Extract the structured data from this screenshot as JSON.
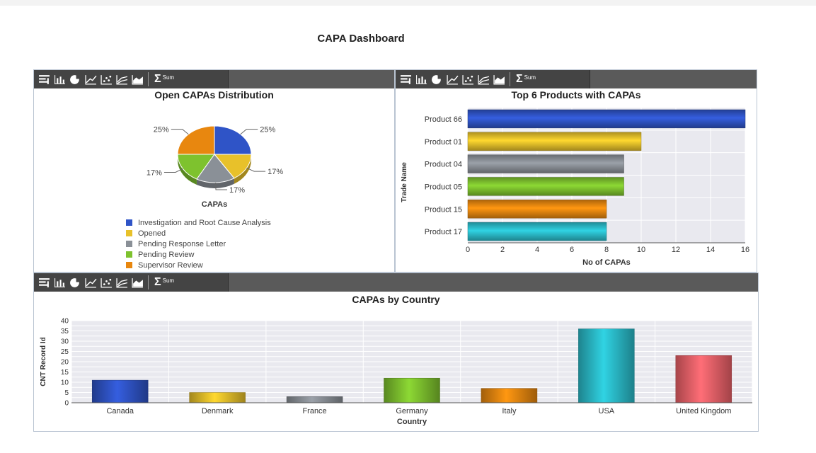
{
  "page_title": "CAPA Dashboard",
  "toolbar": {
    "icons": [
      "grid-icon",
      "bar-chart-icon",
      "pie-chart-icon",
      "line-chart-icon",
      "scatter-chart-icon",
      "multi-line-chart-icon",
      "area-chart-icon",
      "sum-icon"
    ],
    "sum_label": "Sum",
    "sigma": "Σ"
  },
  "chart_data": [
    {
      "type": "pie",
      "title": "Open CAPAs Distribution",
      "xlabel": "CAPAs",
      "slices": [
        {
          "label": "Investigation and Root Cause Analysis",
          "value": 25,
          "pct_label": "25%",
          "color": "#2f54c7"
        },
        {
          "label": "Opened",
          "value": 16,
          "pct_label": "17%",
          "color": "#e8c12a"
        },
        {
          "label": "Pending Response Letter",
          "value": 17,
          "pct_label": "17%",
          "color": "#8a9097"
        },
        {
          "label": "Pending Review",
          "value": 17,
          "pct_label": "17%",
          "color": "#7ec22e"
        },
        {
          "label": "Supervisor Review",
          "value": 25,
          "pct_label": "25%",
          "color": "#e8870f"
        }
      ],
      "legend": "bottom"
    },
    {
      "type": "bar",
      "orientation": "horizontal",
      "title": "Top 6 Products with CAPAs",
      "xlabel": "No of CAPAs",
      "ylabel": "Trade Name",
      "categories": [
        "Product 66",
        "Product 01",
        "Product 04",
        "Product 05",
        "Product 15",
        "Product 17"
      ],
      "values": [
        16,
        10,
        9,
        9,
        8,
        8
      ],
      "colors": [
        "#2f54c7",
        "#e8c12a",
        "#8a9097",
        "#7ec22e",
        "#e8870f",
        "#2bbccb"
      ],
      "xlim": [
        0,
        16
      ],
      "xticks": [
        0,
        2,
        4,
        6,
        8,
        10,
        12,
        14,
        16
      ],
      "grid": true
    },
    {
      "type": "bar",
      "title": "CAPAs by Country",
      "xlabel": "Country",
      "ylabel": "CNT Record Id",
      "categories": [
        "Canada",
        "Denmark",
        "France",
        "Germany",
        "Italy",
        "USA",
        "United Kingdom"
      ],
      "values": [
        11,
        5,
        3,
        12,
        7,
        36,
        23
      ],
      "colors": [
        "#2f54c7",
        "#e8c12a",
        "#8a9097",
        "#7ec22e",
        "#e8870f",
        "#2bbccb",
        "#f0626a"
      ],
      "ylim": [
        0,
        40
      ],
      "yticks": [
        0,
        5,
        10,
        15,
        20,
        25,
        30,
        35,
        40
      ],
      "grid": true
    }
  ]
}
